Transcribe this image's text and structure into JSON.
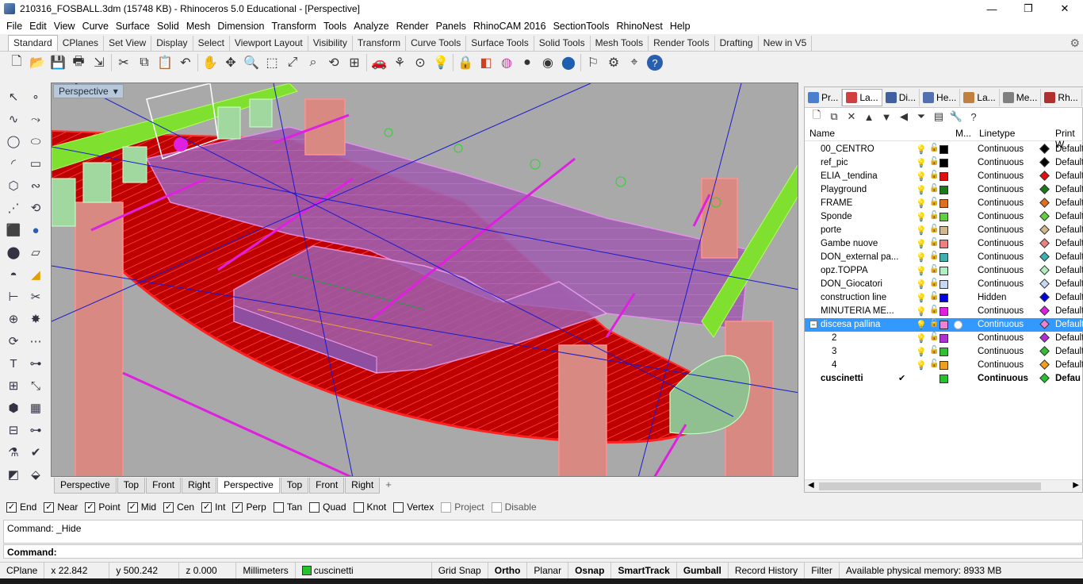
{
  "window": {
    "title": "210316_FOSBALL.3dm (15748 KB) - Rhinoceros 5.0 Educational - [Perspective]",
    "buttons": [
      "—",
      "❐",
      "✕"
    ]
  },
  "menu": [
    "File",
    "Edit",
    "View",
    "Curve",
    "Surface",
    "Solid",
    "Mesh",
    "Dimension",
    "Transform",
    "Tools",
    "Analyze",
    "Render",
    "Panels",
    "RhinoCAM 2016",
    "SectionTools",
    "RhinoNest",
    "Help"
  ],
  "toolbar_tabs": [
    "Standard",
    "CPlanes",
    "Set View",
    "Display",
    "Select",
    "Viewport Layout",
    "Visibility",
    "Transform",
    "Curve Tools",
    "Surface Tools",
    "Solid Tools",
    "Mesh Tools",
    "Render Tools",
    "Drafting",
    "New in V5"
  ],
  "toolbar_icons": [
    "new-icon",
    "open-icon",
    "save-icon",
    "print-icon",
    "import-icon",
    "cut-icon",
    "copy-icon",
    "paste-icon",
    "undo-icon",
    "pan-icon",
    "rotate-icon",
    "zoom-icon",
    "zoom-window-icon",
    "zoom-extents-icon",
    "zoom-selected-icon",
    "rotate-view-icon",
    "four-views-icon",
    "car-icon",
    "named-view-icon",
    "named-cplane-icon",
    "light-icon",
    "lock-icon",
    "material-icon",
    "color-wheel-icon",
    "render-sphere-icon",
    "shaded-sphere-icon",
    "render-preview-icon",
    "select-icon",
    "options-icon",
    "snap-icon",
    "help-icon"
  ],
  "viewport": {
    "label": "Perspective",
    "tabs": [
      "Perspective",
      "Top",
      "Front",
      "Right",
      "Perspective",
      "Top",
      "Front",
      "Right"
    ],
    "active_tab": 4,
    "add_tab": "+"
  },
  "panel": {
    "tabs": [
      {
        "label": "Pr...",
        "color": "#4a7fd0"
      },
      {
        "label": "La...",
        "color": "#d04040"
      },
      {
        "label": "Di...",
        "color": "#4060a0"
      },
      {
        "label": "He...",
        "color": "#5070b0"
      },
      {
        "label": "La...",
        "color": "#c08040"
      },
      {
        "label": "Me...",
        "color": "#808080"
      },
      {
        "label": "Rh...",
        "color": "#b03030"
      }
    ],
    "columns": {
      "name": "Name",
      "material": "M...",
      "linetype": "Linetype",
      "print": "Print W"
    },
    "layers": [
      {
        "name": "00_CENTRO",
        "color": "#000000",
        "linetype": "Continuous",
        "print": "Default",
        "print_color": "#000000",
        "bulb": "#d4a800"
      },
      {
        "name": "ref_pic",
        "color": "#000000",
        "linetype": "Continuous",
        "print": "Default",
        "print_color": "#000000",
        "bulb": "#4090d0"
      },
      {
        "name": "ELIA _tendina",
        "color": "#e01010",
        "linetype": "Continuous",
        "print": "Default",
        "print_color": "#e01010",
        "bulb": "#d4a800"
      },
      {
        "name": "Playground",
        "color": "#1a7a1a",
        "linetype": "Continuous",
        "print": "Default",
        "print_color": "#1a7a1a",
        "bulb": "#4090d0"
      },
      {
        "name": "FRAME",
        "color": "#e07020",
        "linetype": "Continuous",
        "print": "Default",
        "print_color": "#e07020",
        "bulb": "#4090d0"
      },
      {
        "name": "Sponde",
        "color": "#60d040",
        "linetype": "Continuous",
        "print": "Default",
        "print_color": "#60d040",
        "bulb": "#d4a800"
      },
      {
        "name": "porte",
        "color": "#d0b890",
        "linetype": "Continuous",
        "print": "Default",
        "print_color": "#d0b890",
        "bulb": "#d4a800"
      },
      {
        "name": "Gambe nuove",
        "color": "#f08080",
        "linetype": "Continuous",
        "print": "Default",
        "print_color": "#f08080",
        "bulb": "#d4a800"
      },
      {
        "name": "DON_external pa...",
        "color": "#40b0b0",
        "linetype": "Continuous",
        "print": "Default",
        "print_color": "#40b0b0",
        "bulb": "#4090d0"
      },
      {
        "name": "opz.TOPPA",
        "color": "#b0f0c0",
        "linetype": "Continuous",
        "print": "Default",
        "print_color": "#b0f0c0",
        "bulb": "#d4a800"
      },
      {
        "name": "DON_Giocatori",
        "color": "#c8d8f0",
        "linetype": "Continuous",
        "print": "Default",
        "print_color": "#c8d8f0",
        "bulb": "#4090d0"
      },
      {
        "name": "construction line",
        "color": "#0000e0",
        "linetype": "Hidden",
        "print": "Default",
        "print_color": "#0000e0",
        "bulb": "#d4a800"
      },
      {
        "name": "MINUTERIA ME...",
        "color": "#e020e0",
        "linetype": "Continuous",
        "print": "Default",
        "print_color": "#e020e0",
        "bulb": "#d4a800"
      },
      {
        "name": "discesa pallina",
        "color": "#f080d0",
        "linetype": "Continuous",
        "print": "Default",
        "print_color": "#f080d0",
        "bulb": "#d4a800",
        "selected": true,
        "expander": "−"
      },
      {
        "name": "2",
        "color": "#b030d0",
        "linetype": "Continuous",
        "print": "Default",
        "print_color": "#b030d0",
        "bulb": "#d4a800",
        "sub": true
      },
      {
        "name": "3",
        "color": "#30c030",
        "linetype": "Continuous",
        "print": "Default",
        "print_color": "#30c030",
        "bulb": "#d4a800",
        "sub": true
      },
      {
        "name": "4",
        "color": "#f0a020",
        "linetype": "Continuous",
        "print": "Default",
        "print_color": "#f0a020",
        "bulb": "#d4a800",
        "sub": true
      },
      {
        "name": "cuscinetti",
        "color": "#22c42a",
        "linetype": "Continuous",
        "print": "Defau",
        "print_color": "#22c42a",
        "bold": true,
        "current": true,
        "check": "✔"
      }
    ]
  },
  "osnap": [
    {
      "label": "End",
      "checked": true
    },
    {
      "label": "Near",
      "checked": true
    },
    {
      "label": "Point",
      "checked": true
    },
    {
      "label": "Mid",
      "checked": true
    },
    {
      "label": "Cen",
      "checked": true
    },
    {
      "label": "Int",
      "checked": true
    },
    {
      "label": "Perp",
      "checked": true
    },
    {
      "label": "Tan",
      "checked": false
    },
    {
      "label": "Quad",
      "checked": false
    },
    {
      "label": "Knot",
      "checked": false
    },
    {
      "label": "Vertex",
      "checked": false
    },
    {
      "label": "Project",
      "checked": false,
      "dim": true
    },
    {
      "label": "Disable",
      "checked": false,
      "dim": true
    }
  ],
  "command": {
    "history": "Command: _Hide",
    "prompt": "Command:"
  },
  "status": {
    "cplane": "CPlane",
    "x": "x 22.842",
    "y": "y 500.242",
    "z": "z 0.000",
    "units": "Millimeters",
    "layer": "cuscinetti",
    "layer_color": "#22c42a",
    "toggles": [
      {
        "label": "Grid Snap",
        "bold": false
      },
      {
        "label": "Ortho",
        "bold": true
      },
      {
        "label": "Planar",
        "bold": false
      },
      {
        "label": "Osnap",
        "bold": true
      },
      {
        "label": "SmartTrack",
        "bold": true
      },
      {
        "label": "Gumball",
        "bold": true
      },
      {
        "label": "Record History",
        "bold": false
      },
      {
        "label": "Filter",
        "bold": false
      }
    ],
    "memory": "Available physical memory: 8933 MB"
  }
}
